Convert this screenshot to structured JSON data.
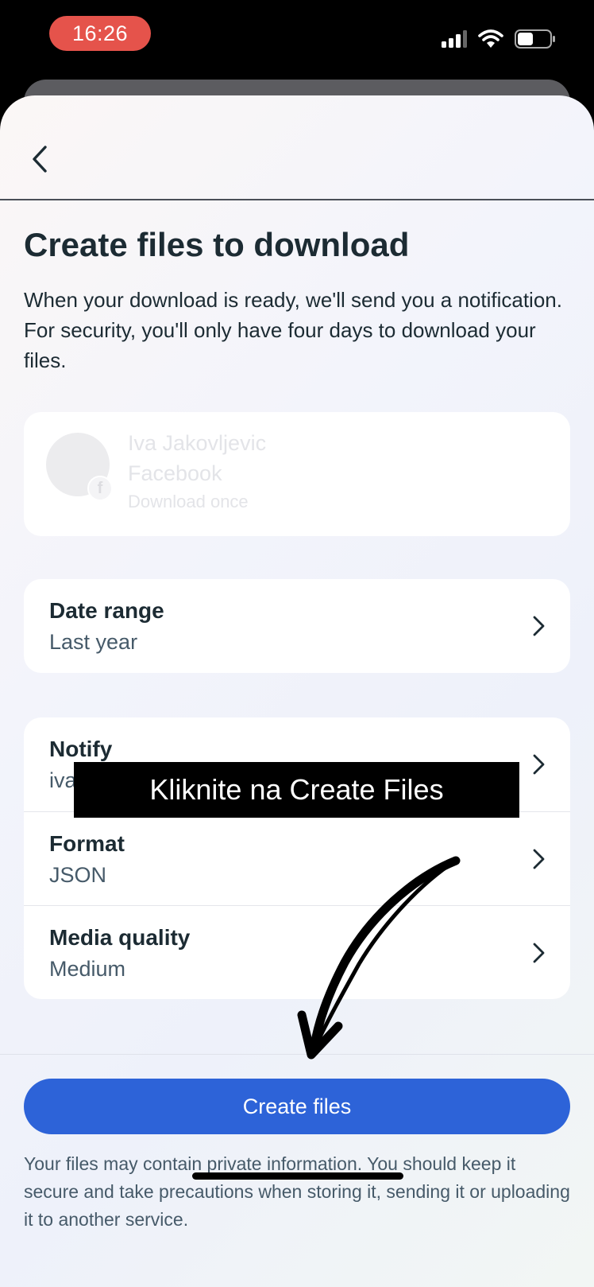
{
  "status_bar": {
    "time": "16:26",
    "icons": [
      "signal-icon",
      "wifi-icon",
      "battery-icon"
    ]
  },
  "nav": {
    "back_icon": "chevron-left-icon"
  },
  "page": {
    "title": "Create files to download",
    "description": "When your download is ready, we'll send you a notification. For security, you'll only have four days to download your files."
  },
  "account": {
    "name": "Iva Jakovljevic",
    "app": "Facebook",
    "frequency": "Download once",
    "badge_icon": "facebook-icon"
  },
  "settings": {
    "date_range": {
      "label": "Date range",
      "value": "Last year"
    },
    "notify": {
      "label": "Notify",
      "value": "iva"
    },
    "format": {
      "label": "Format",
      "value": "JSON"
    },
    "media_quality": {
      "label": "Media quality",
      "value": "Medium"
    }
  },
  "overlay": {
    "caption": "Kliknite na Create Files",
    "arrow_icon": "hand-drawn-arrow-icon"
  },
  "actions": {
    "create_files_label": "Create files"
  },
  "footer": {
    "disclaimer": "Your files may contain private information. You should keep it secure and take precautions when storing it, sending it or uploading it to another service."
  },
  "colors": {
    "primary": "#2d63d8",
    "time_pill": "#e5534b",
    "text_dark": "#1c2b33",
    "text_muted": "#465a69"
  }
}
